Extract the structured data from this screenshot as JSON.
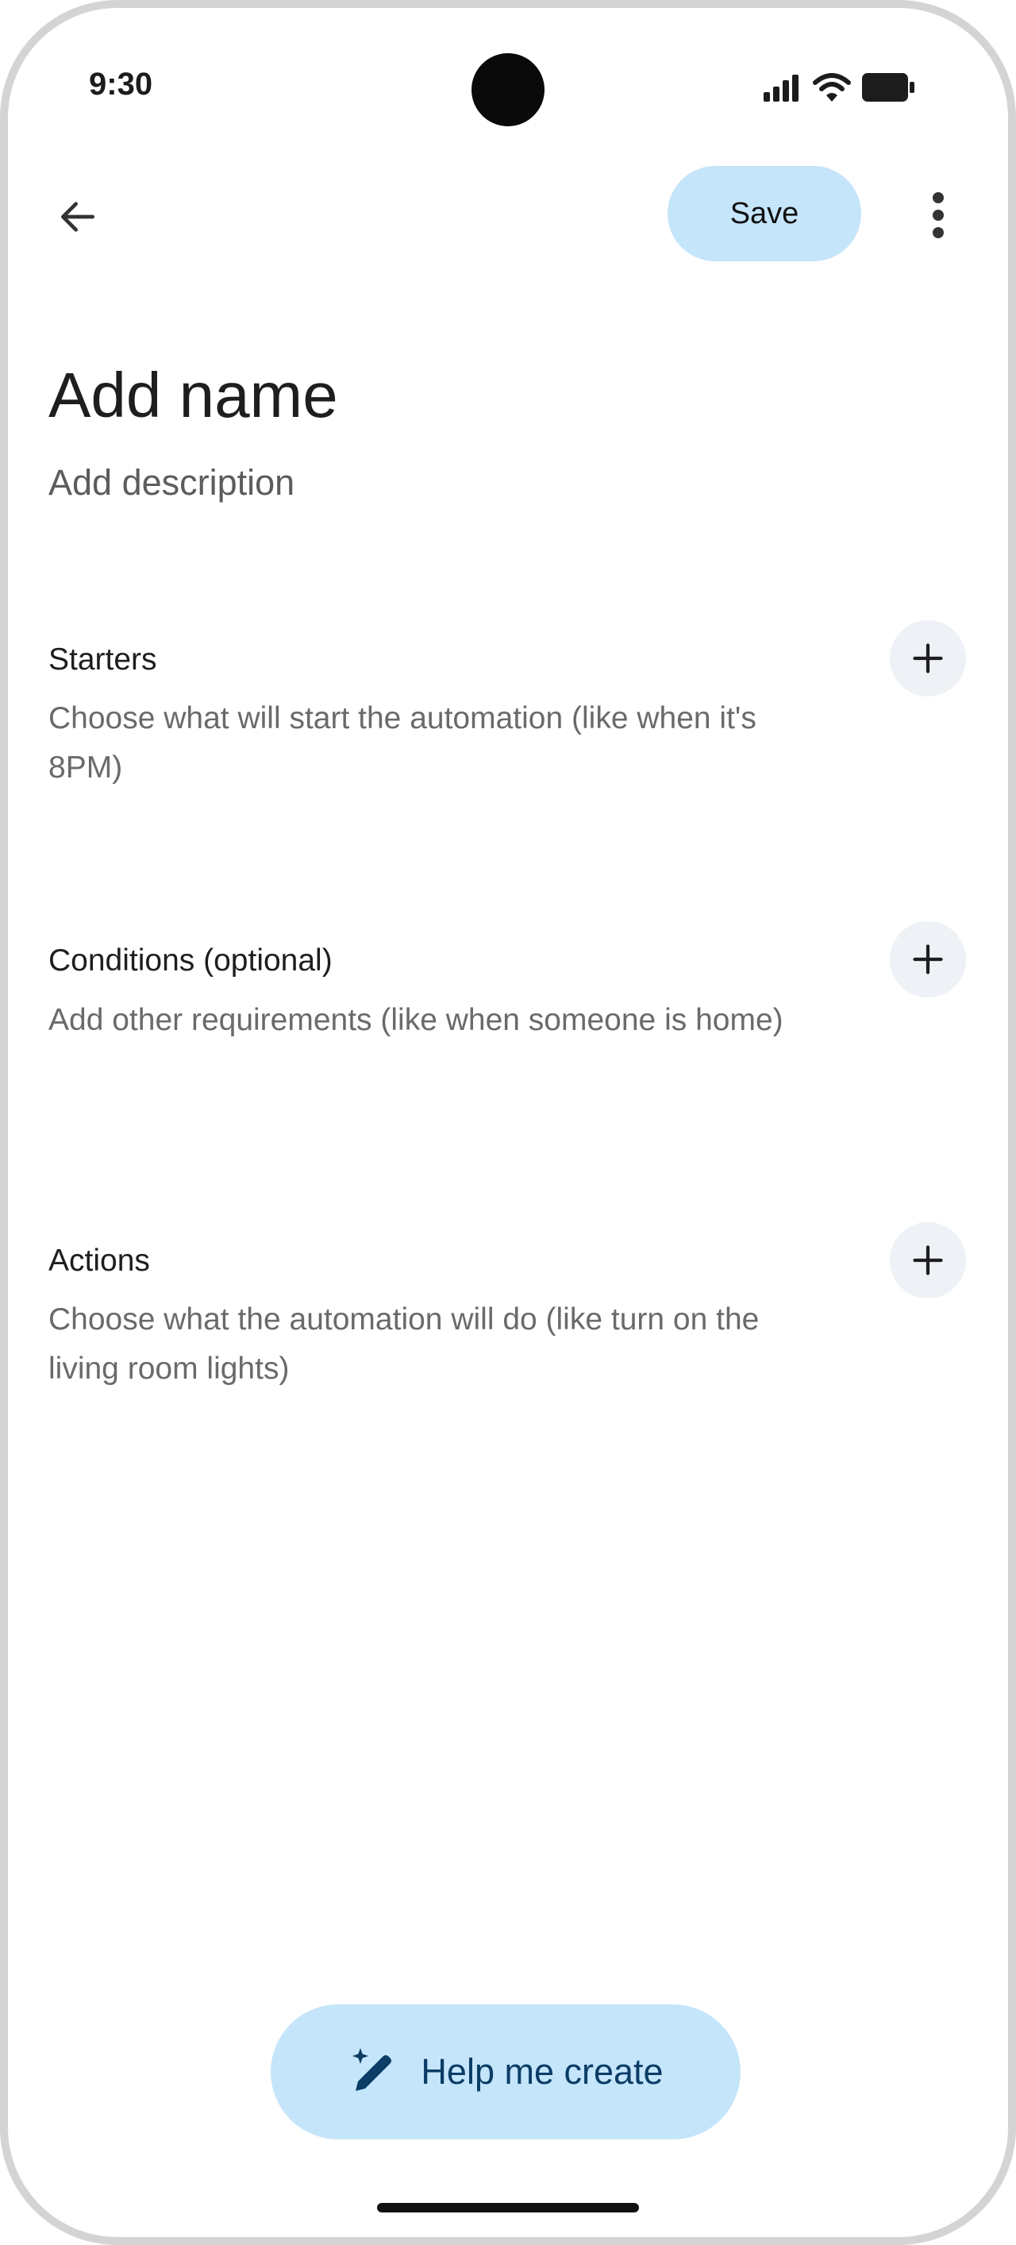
{
  "status_bar": {
    "time": "9:30"
  },
  "header": {
    "back_icon": "arrow-left-icon",
    "save_label": "Save",
    "more_icon": "more-vert-icon"
  },
  "automation": {
    "name_placeholder": "Add name",
    "description_placeholder": "Add description"
  },
  "sections": [
    {
      "title": "Starters",
      "text": "Choose what will start the automation (like when it's 8PM)",
      "add_icon": "plus-icon"
    },
    {
      "title": "Conditions (optional)",
      "text": "Add other requirements (like when someone is home)",
      "add_icon": "plus-icon"
    },
    {
      "title": "Actions",
      "text": "Choose what the automation will do (like turn on the living room lights)",
      "add_icon": "plus-icon"
    }
  ],
  "help_button": {
    "label": "Help me create",
    "icon": "sparkle-pen-icon"
  },
  "colors": {
    "accent_container": "#c5e5fb",
    "on_accent": "#0b3d66",
    "add_button_bg": "#eef1f5"
  }
}
